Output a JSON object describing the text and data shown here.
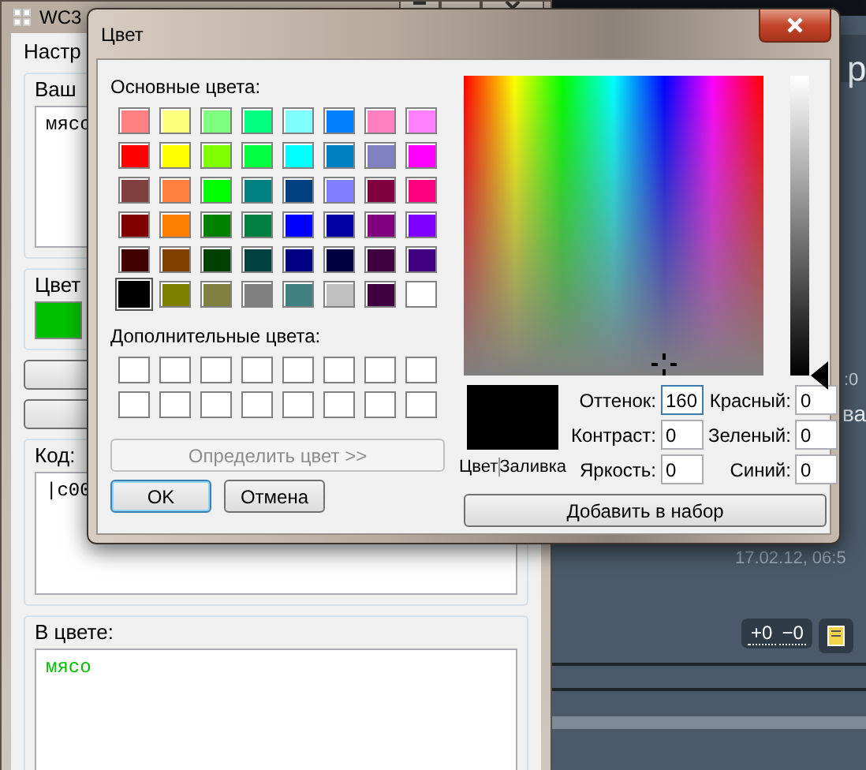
{
  "back_window": {
    "title": "WC3",
    "section_label": "Настр",
    "text_group": {
      "label": "Ваш",
      "value": "мясо"
    },
    "color_group": {
      "label": "Цвет",
      "color": "#00c000"
    },
    "code_group": {
      "label": "Код:",
      "value": "|c00"
    },
    "result_group": {
      "label": "В цвете:",
      "value": "мясо",
      "color": "#00c000"
    }
  },
  "background_app": {
    "heading_fragment": "р",
    "time_fragment": ":0",
    "text_fragment": "ва",
    "timestamp": "17.02.12, 06:5",
    "vote_buttons": [
      "+0",
      "−0"
    ]
  },
  "dialog": {
    "title": "Цвет",
    "basic_label": "Основные цвета:",
    "basic_colors": [
      {
        "color": "#ff8080",
        "selected": false
      },
      {
        "color": "#ffff80",
        "selected": false
      },
      {
        "color": "#80ff80",
        "selected": false
      },
      {
        "color": "#00ff80",
        "selected": false
      },
      {
        "color": "#80ffff",
        "selected": false
      },
      {
        "color": "#0080ff",
        "selected": false
      },
      {
        "color": "#ff80c0",
        "selected": false
      },
      {
        "color": "#ff80ff",
        "selected": false
      },
      {
        "color": "#ff0000",
        "selected": false
      },
      {
        "color": "#ffff00",
        "selected": false
      },
      {
        "color": "#80ff00",
        "selected": false
      },
      {
        "color": "#00ff40",
        "selected": false
      },
      {
        "color": "#00ffff",
        "selected": false
      },
      {
        "color": "#0080c0",
        "selected": false
      },
      {
        "color": "#8080c0",
        "selected": false
      },
      {
        "color": "#ff00ff",
        "selected": false
      },
      {
        "color": "#804040",
        "selected": false
      },
      {
        "color": "#ff8040",
        "selected": false
      },
      {
        "color": "#00ff00",
        "selected": false
      },
      {
        "color": "#008080",
        "selected": false
      },
      {
        "color": "#004080",
        "selected": false
      },
      {
        "color": "#8080ff",
        "selected": false
      },
      {
        "color": "#800040",
        "selected": false
      },
      {
        "color": "#ff0080",
        "selected": false
      },
      {
        "color": "#800000",
        "selected": false
      },
      {
        "color": "#ff8000",
        "selected": false
      },
      {
        "color": "#008000",
        "selected": false
      },
      {
        "color": "#008040",
        "selected": false
      },
      {
        "color": "#0000ff",
        "selected": false
      },
      {
        "color": "#0000a0",
        "selected": false
      },
      {
        "color": "#800080",
        "selected": false
      },
      {
        "color": "#8000ff",
        "selected": false
      },
      {
        "color": "#400000",
        "selected": false
      },
      {
        "color": "#804000",
        "selected": false
      },
      {
        "color": "#004000",
        "selected": false
      },
      {
        "color": "#004040",
        "selected": false
      },
      {
        "color": "#000080",
        "selected": false
      },
      {
        "color": "#000040",
        "selected": false
      },
      {
        "color": "#400040",
        "selected": false
      },
      {
        "color": "#400080",
        "selected": false
      },
      {
        "color": "#000000",
        "selected": true
      },
      {
        "color": "#808000",
        "selected": false
      },
      {
        "color": "#808040",
        "selected": false
      },
      {
        "color": "#808080",
        "selected": false
      },
      {
        "color": "#408080",
        "selected": false
      },
      {
        "color": "#c0c0c0",
        "selected": false
      },
      {
        "color": "#400040",
        "selected": false
      },
      {
        "color": "#ffffff",
        "selected": false
      }
    ],
    "custom_label": "Дополнительные цвета:",
    "custom_colors": [
      {
        "color": "#ffffff",
        "selected": false
      },
      {
        "color": "#ffffff",
        "selected": false
      },
      {
        "color": "#ffffff",
        "selected": false
      },
      {
        "color": "#ffffff",
        "selected": false
      },
      {
        "color": "#ffffff",
        "selected": false
      },
      {
        "color": "#ffffff",
        "selected": false
      },
      {
        "color": "#ffffff",
        "selected": false
      },
      {
        "color": "#ffffff",
        "selected": false
      },
      {
        "color": "#ffffff",
        "selected": false
      },
      {
        "color": "#ffffff",
        "selected": false
      },
      {
        "color": "#ffffff",
        "selected": false
      },
      {
        "color": "#ffffff",
        "selected": false
      },
      {
        "color": "#ffffff",
        "selected": false
      },
      {
        "color": "#ffffff",
        "selected": false
      },
      {
        "color": "#ffffff",
        "selected": false
      },
      {
        "color": "#ffffff",
        "selected": false
      }
    ],
    "define_button": {
      "label": "Определить цвет >>",
      "disabled": true
    },
    "ok_button": "OK",
    "cancel_button": "Отмена",
    "luminance": {
      "level": 0
    },
    "preview": {
      "color": "#000000",
      "label_left": "Цвет",
      "label_right": "Заливка"
    },
    "fields": [
      {
        "label": "Оттенок:",
        "value": "160",
        "focused": true
      },
      {
        "label": "Красный:",
        "value": "0",
        "focused": false
      },
      {
        "label": "Контраст:",
        "value": "0",
        "focused": false
      },
      {
        "label": "Зеленый:",
        "value": "0",
        "focused": false
      },
      {
        "label": "Яркость:",
        "value": "0",
        "focused": false
      },
      {
        "label": "Синий:",
        "value": "0",
        "focused": false
      }
    ],
    "add_button": "Добавить в набор"
  }
}
